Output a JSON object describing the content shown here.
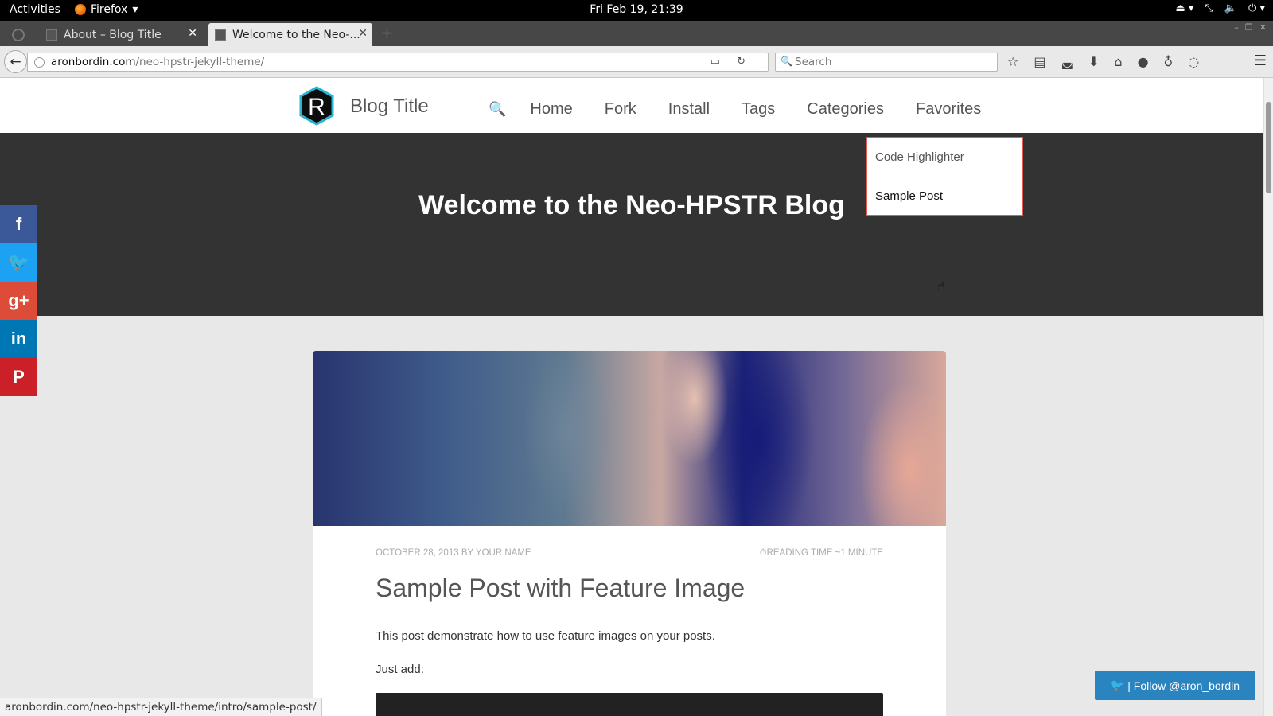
{
  "system_bar": {
    "activities": "Activities",
    "app_name": "Firefox",
    "clock": "Fri Feb 19, 21:39"
  },
  "browser": {
    "tabs": [
      {
        "label": "About – Blog Title"
      },
      {
        "label": "Welcome to the Neo-..."
      }
    ],
    "url_host": "aronbordin.com",
    "url_path": "/neo-hpstr-jekyll-theme/",
    "search_placeholder": "Search",
    "status_url": "aronbordin.com/neo-hpstr-jekyll-theme/intro/sample-post/"
  },
  "site": {
    "blog_title": "Blog Title",
    "nav": [
      {
        "label": "Home"
      },
      {
        "label": "Fork"
      },
      {
        "label": "Install"
      },
      {
        "label": "Tags"
      },
      {
        "label": "Categories"
      },
      {
        "label": "Favorites"
      }
    ],
    "dropdown": [
      {
        "label": "Code Highlighter"
      },
      {
        "label": "Sample Post"
      }
    ],
    "hero_title": "Welcome to the Neo-HPSTR Blog",
    "social": [
      {
        "glyph": "f",
        "color": "#3b5998"
      },
      {
        "glyph": "t",
        "color": "#1da1f2"
      },
      {
        "glyph": "g+",
        "color": "#dd4b39"
      },
      {
        "glyph": "in",
        "color": "#0077b5"
      },
      {
        "glyph": "P",
        "color": "#cb2027"
      }
    ],
    "post": {
      "date_author": "OCTOBER 28, 2013 BY YOUR NAME",
      "reading_time": "READING TIME ~1 MINUTE",
      "title": "Sample Post with Feature Image",
      "paragraph1": "This post demonstrate how to use feature images on your posts.",
      "paragraph2": "Just add:"
    },
    "follow_button": "| Follow @aron_bordin"
  },
  "colors": {
    "accent": "#e55b4f",
    "hero_bg": "#333333",
    "follow_bg": "#2a84c0"
  }
}
